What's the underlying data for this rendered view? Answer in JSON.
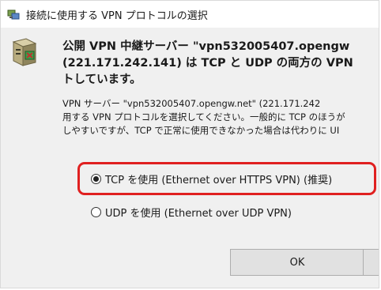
{
  "window": {
    "title": "接続に使用する VPN プロトコルの選択"
  },
  "header": {
    "line1": "公開 VPN 中継サーバー \"vpn532005407.opengw",
    "line2": "(221.171.242.141) は TCP と UDP の両方の VPN",
    "line3": "トしています。"
  },
  "description": {
    "line1": "VPN サーバー \"vpn532005407.opengw.net\" (221.171.242",
    "line2": "用する VPN プロトコルを選択してください。一般的に TCP のほうが",
    "line3": "しやすいですが、TCP で正常に使用できなかった場合は代わりに UI"
  },
  "options": {
    "tcp_label": "TCP を使用 (Ethernet over HTTPS VPN) (推奨)",
    "tcp_selected": true,
    "udp_label": "UDP を使用 (Ethernet over UDP VPN)",
    "udp_selected": false
  },
  "buttons": {
    "ok_label": "OK",
    "cancel_label": ""
  },
  "colors": {
    "highlight": "#e02020",
    "dialog_bg": "#f0f0f0"
  },
  "icons": {
    "title": "vpn-network-icon",
    "main": "vpn-server-icon"
  }
}
